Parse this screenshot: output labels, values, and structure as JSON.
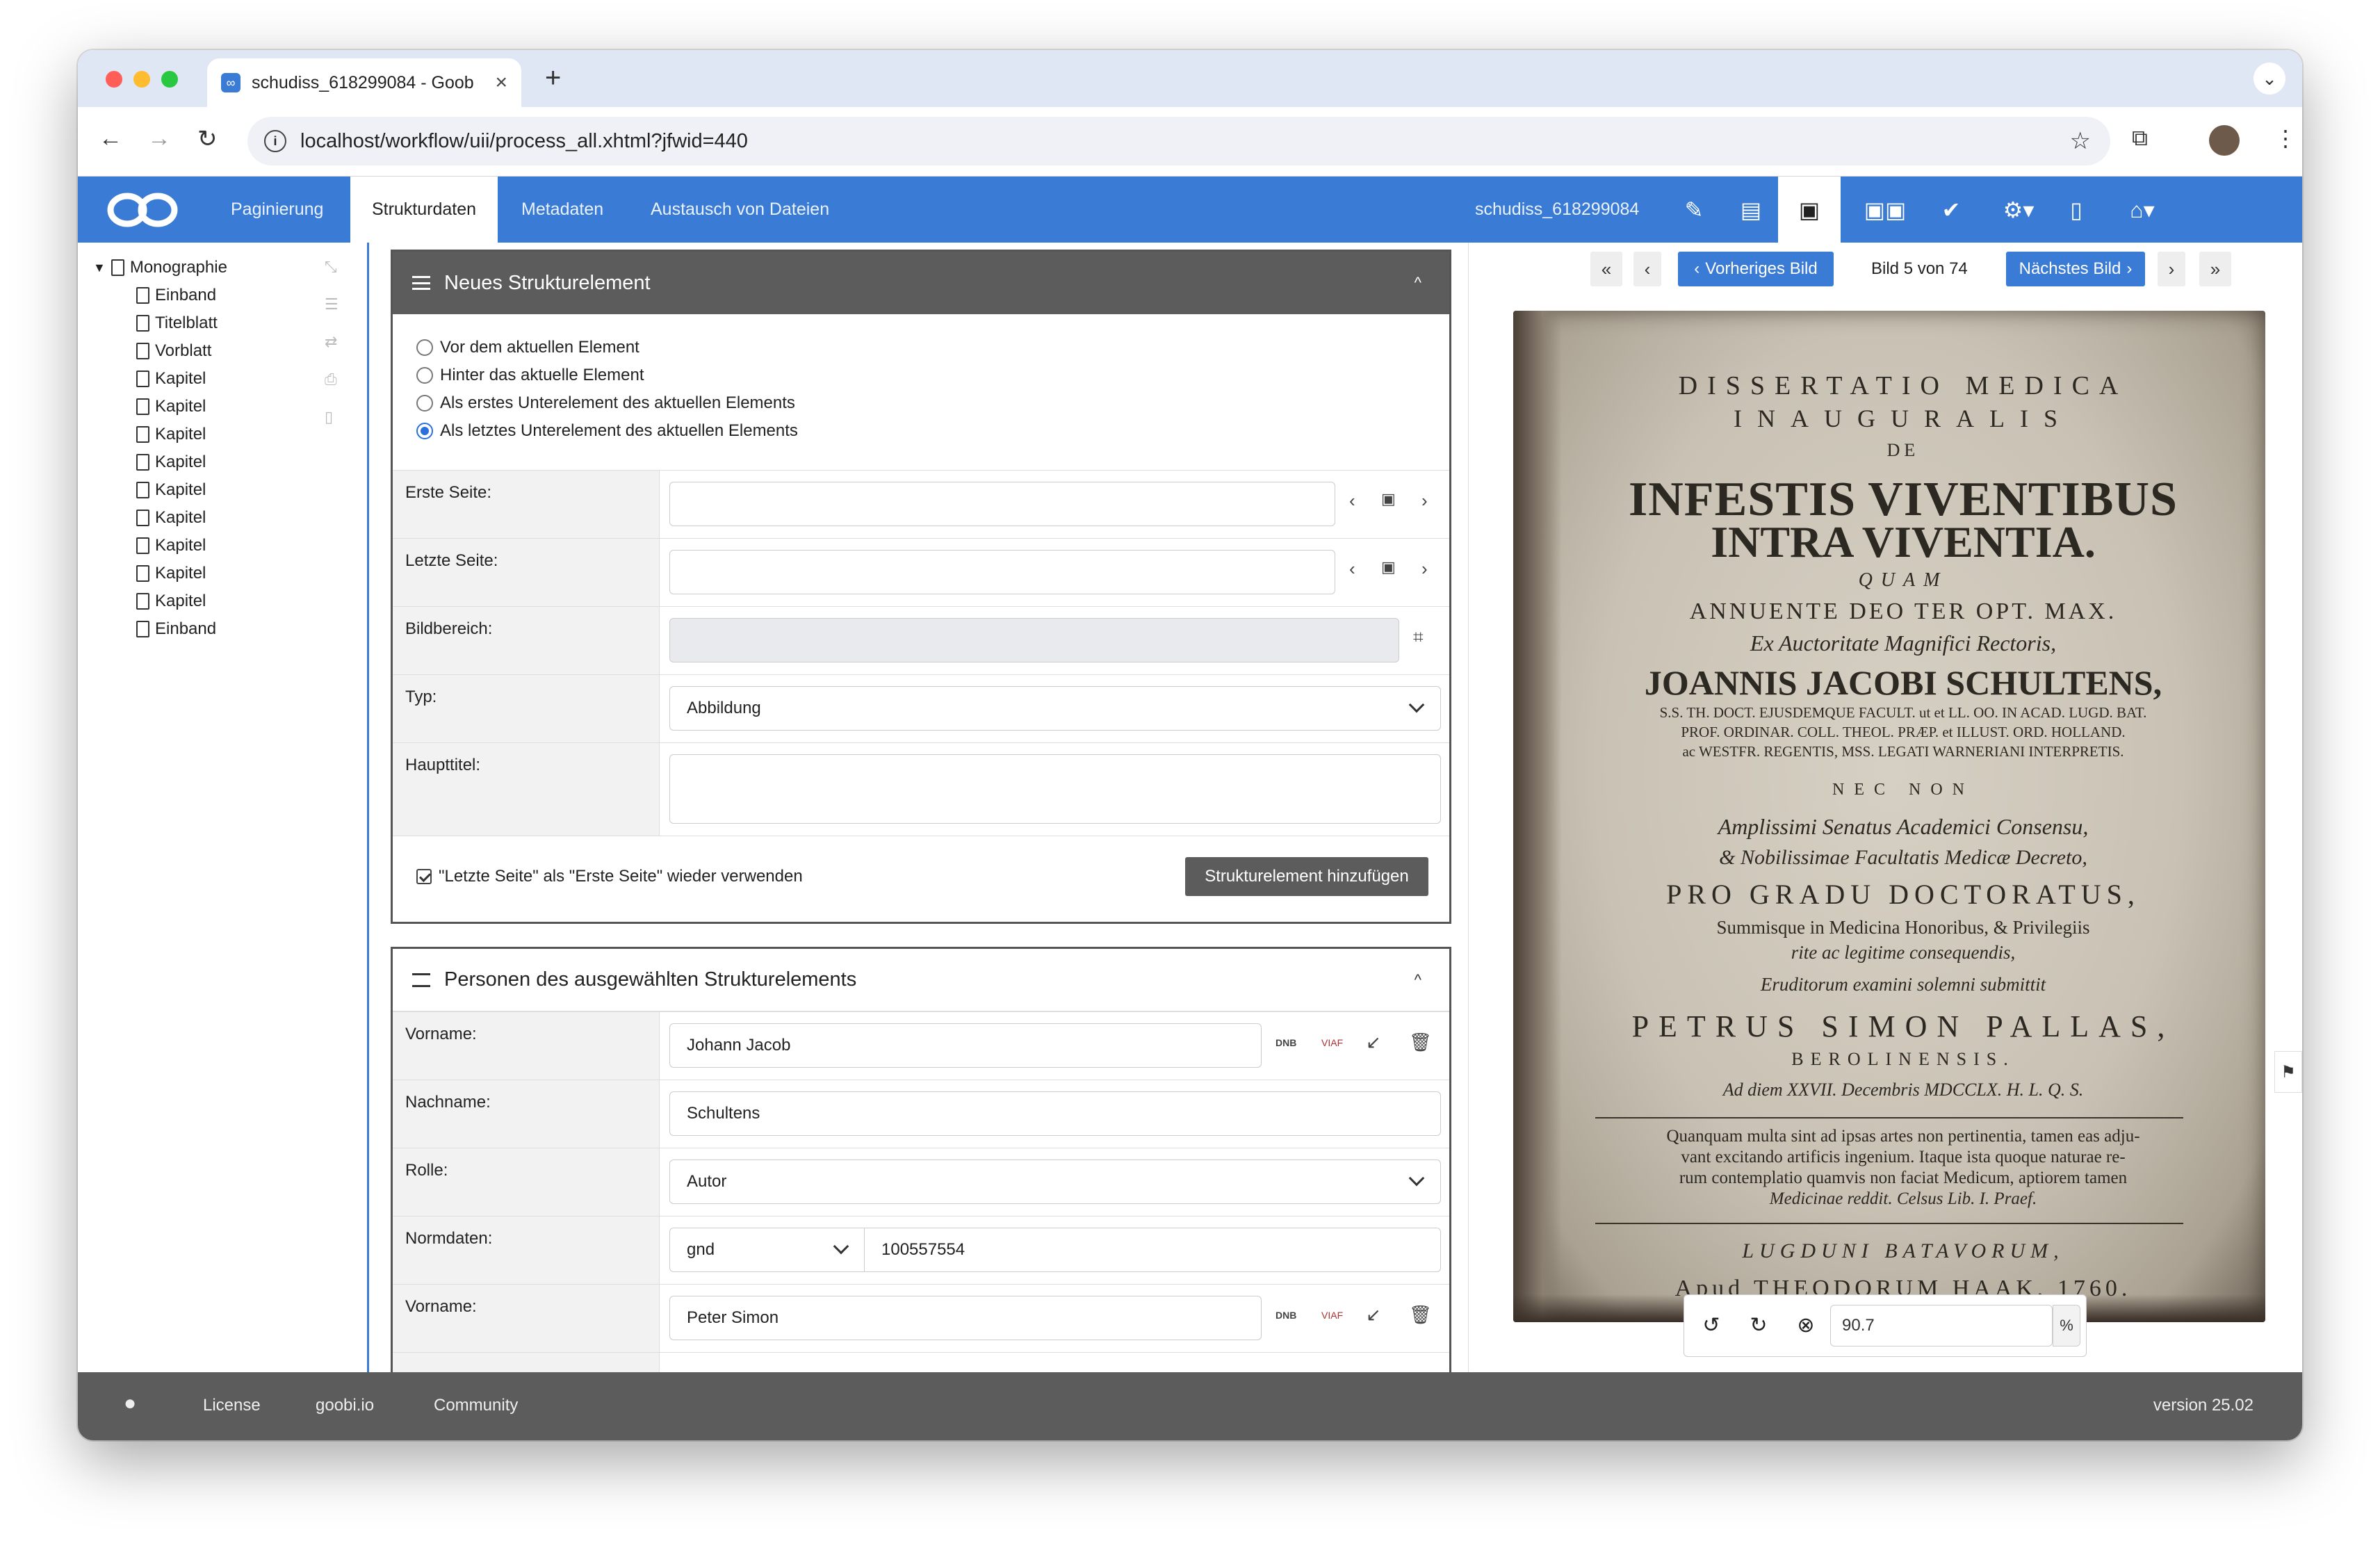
{
  "browser": {
    "tab_title": "schudiss_618299084 - Goob",
    "url": "localhost/workflow/uii/process_all.xhtml?jfwid=440"
  },
  "nav": {
    "tabs": [
      "Paginierung",
      "Strukturdaten",
      "Metadaten",
      "Austausch von Dateien"
    ],
    "active_tab": "Strukturdaten",
    "process_id": "schudiss_618299084",
    "accent_color": "#3a7bd5"
  },
  "tree": {
    "root": "Monographie",
    "children": [
      "Einband",
      "Titelblatt",
      "Vorblatt",
      "Kapitel",
      "Kapitel",
      "Kapitel",
      "Kapitel",
      "Kapitel",
      "Kapitel",
      "Kapitel",
      "Kapitel",
      "Kapitel",
      "Einband"
    ]
  },
  "new_struct": {
    "title": "Neues Strukturelement",
    "radios": [
      "Vor dem aktuellen Element",
      "Hinter das aktuelle Element",
      "Als erstes Unterelement des aktuellen Elements",
      "Als letztes Unterelement des aktuellen Elements"
    ],
    "selected_radio": "Als letztes Unterelement des aktuellen Elements",
    "labels": {
      "first_page": "Erste Seite:",
      "last_page": "Letzte Seite:",
      "image_area": "Bildbereich:",
      "type": "Typ:",
      "main_title": "Haupttitel:"
    },
    "type_value": "Abbildung",
    "reuse_checkbox": "\"Letzte Seite\" als \"Erste Seite\" wieder verwenden",
    "reuse_checked": true,
    "add_button": "Strukturelement hinzufügen"
  },
  "persons": {
    "title": "Personen des ausgewählten Strukturelements",
    "labels": {
      "firstname": "Vorname:",
      "lastname": "Nachname:",
      "role": "Rolle:",
      "authority": "Normdaten:"
    },
    "person1": {
      "firstname": "Johann Jacob",
      "lastname": "Schultens",
      "role": "Autor",
      "authority_source": "gnd",
      "authority_id": "100557554"
    },
    "person2": {
      "firstname": "Peter Simon"
    },
    "dnb_label": "DNB",
    "viaf_label": "VIAF"
  },
  "viewer": {
    "prev_label": "Vorheriges Bild",
    "next_label": "Nächstes Bild",
    "counter": "Bild 5 von 74",
    "zoom_value": "90.7",
    "zoom_unit": "%"
  },
  "scan_text": [
    "DISSERTATIO MEDICA",
    "INAUGURALIS",
    "DE",
    "INFESTIS VIVENTIBUS",
    "INTRA VIVENTIA.",
    "QUAM",
    "ANNUENTE DEO TER OPT. MAX.",
    "Ex Auctoritate Magnifici Rectoris,",
    "JOANNIS JACOBI SCHULTENS,",
    "S.S. TH. DOCT. EJUSDEMQUE FACULT. ut et LL. OO. IN ACAD. LUGD. BAT.",
    "PROF. ORDINAR. COLL. THEOL. PRÆP. et ILLUST. ORD. HOLLAND.",
    "ac WESTFR. REGENTIS, MSS. LEGATI WARNERIANI INTERPRETIS.",
    "NEC NON",
    "Amplissimi Senatus Academici Consensu,",
    "& Nobilissimae Facultatis Medicæ Decreto,",
    "PRO GRADU DOCTORATUS,",
    "Summisque in Medicina Honoribus, & Privilegiis",
    "rite ac legitime consequendis,",
    "Eruditorum examini solemni submittit",
    "PETRUS SIMON PALLAS,",
    "BEROLINENSIS.",
    "Ad diem XXVII. Decembris MDCCLX. H. L. Q. S.",
    "Quanquam multa sint ad ipsas artes non pertinentia, tamen eas adju-",
    "vant excitando artificis ingenium. Itaque ista quoque naturae re-",
    "rum contemplatio quamvis non faciat Medicum, aptiorem tamen",
    "Medicinae reddit. Celsus Lib. I. Praef.",
    "LUGDUNI BATAVORUM,",
    "Apud THEODORUM HAAK, 1760."
  ],
  "footer": {
    "links": [
      "License",
      "goobi.io",
      "Community"
    ],
    "version": "version 25.02"
  }
}
